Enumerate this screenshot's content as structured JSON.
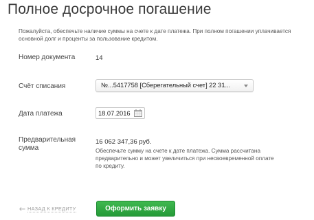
{
  "page": {
    "title": "Полное досрочное погашение",
    "notice": "Пожалуйста, обеспечьте наличие суммы на счете к дате платежа. При полном погашении уплачивается основной долг и проценты за пользование кредитом."
  },
  "form": {
    "document_number": {
      "label": "Номер документа",
      "value": "14"
    },
    "debit_account": {
      "label": "Счёт списания",
      "selected": "№...5417758  [Сберегательный счет] 22 31..."
    },
    "payment_date": {
      "label": "Дата платежа",
      "value": "18.07.2016"
    },
    "preliminary_amount": {
      "label_line1": "Предварительная",
      "label_line2": "сумма",
      "value": "16 062 347,36 руб.",
      "note": "Обеспечьте сумму на счете к дате платежа. Сумма рассчитана предварительно и может увеличиться при несвоевременной оплате по кредиту."
    }
  },
  "actions": {
    "back_label": "НАЗАД К КРЕДИТУ",
    "submit_label": "Оформить заявку"
  },
  "colors": {
    "primary_green": "#2ea443",
    "text": "#333333",
    "muted": "#9a9a9a"
  },
  "icons": {
    "back": "back-arrow-icon",
    "calendar": "calendar-icon",
    "dropdown": "chevron-down-icon"
  }
}
